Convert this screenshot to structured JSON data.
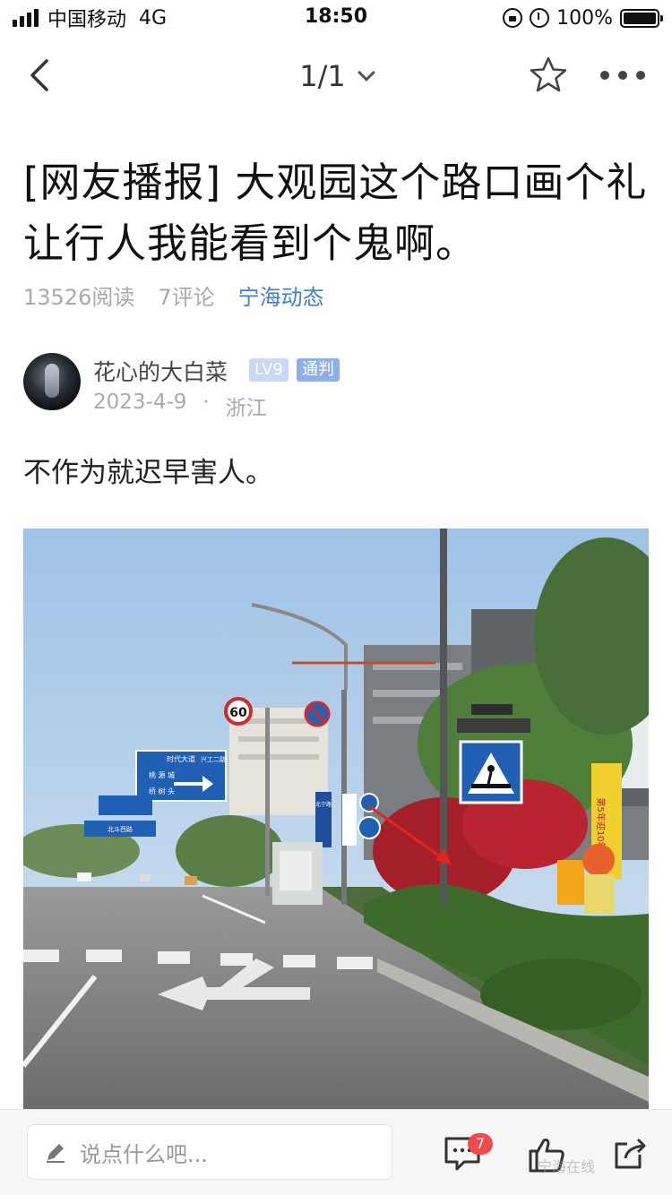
{
  "status_bar": {
    "carrier": "中国移动",
    "network": "4G",
    "time": "18:50",
    "battery": "100%",
    "icons": [
      "signal-icon",
      "rotation-lock-icon",
      "alarm-icon",
      "battery-icon"
    ]
  },
  "nav": {
    "back_icon": "back-chevron-icon",
    "page_indicator": "1/1",
    "dropdown_icon": "chevron-down-icon",
    "favorite_icon": "star-icon",
    "more_icon": "more-dots-icon"
  },
  "post": {
    "title": "[网友播报] 大观园这个路口画个礼让行人我能看到个鬼啊。",
    "reads": "13526阅读",
    "comments": "7评论",
    "channel": "宁海动态",
    "author": {
      "name": "花心的大白菜",
      "level": "LV9",
      "role": "通判",
      "date": "2023-4-9",
      "separator": "·",
      "location": "浙江"
    },
    "body": "不作为就迟早害人。"
  },
  "photo": {
    "sign_60": "60",
    "guide_sign_top": "时代大道",
    "guide_sign_right": "兴工二路",
    "guide_sign_left1": "桃 源 城",
    "guide_sign_left2": "桥 树 头",
    "guide_sign_mid": "北斗西路",
    "tall_sign": "北宁路",
    "banner": "第5年迎10年"
  },
  "bottom_bar": {
    "comment_placeholder": "说点什么吧...",
    "comment_count": "7",
    "watermark": "宁海在线"
  },
  "colors": {
    "accent": "#3f7fd6",
    "badge_red": "#ef4b4b",
    "level_badge": "#c9d9f4",
    "role_badge": "#8bb0ec"
  }
}
